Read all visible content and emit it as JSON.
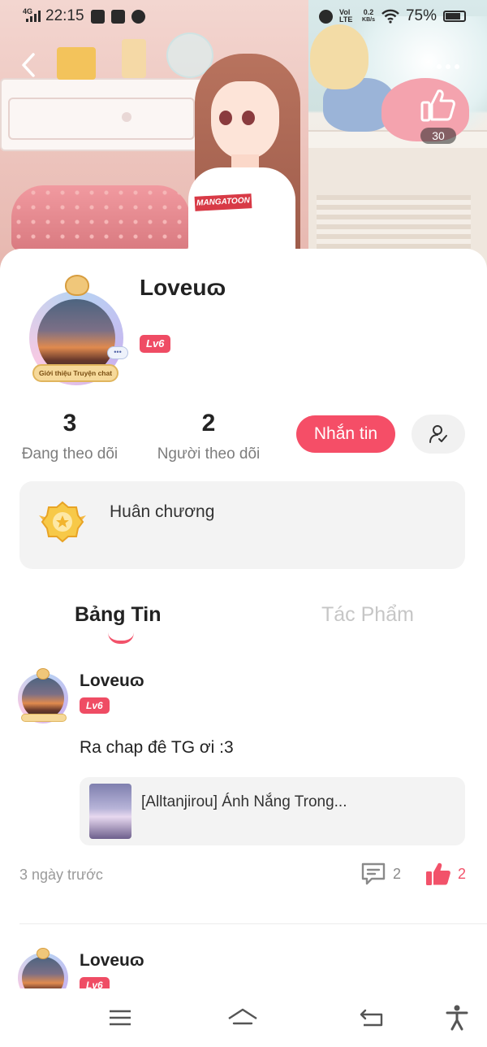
{
  "status_bar": {
    "network": "4G",
    "time": "22:15",
    "volte": "Vol LTE",
    "speed": "0.2",
    "speed_unit": "KB/s",
    "battery": "75%"
  },
  "header": {
    "back_icon": "chevron-left-icon",
    "more_icon": "more-dots-icon",
    "like_icon": "thumbs-up-icon",
    "likes": "30",
    "shirt_text": "MANGATOON"
  },
  "profile": {
    "username": "Loveuɷ",
    "level": "Lv6",
    "frame_caption": "Giới thiệu Truyện chat",
    "frame_bubble": "•••",
    "following_count": "3",
    "following_label": "Đang theo dõi",
    "followers_count": "2",
    "followers_label": "Người theo dõi",
    "message_button": "Nhắn tin",
    "follow_icon": "user-check-icon"
  },
  "medal": {
    "label": "Huân chương",
    "icon": "medal-badge-icon"
  },
  "tabs": [
    {
      "label": "Bảng Tin",
      "active": true
    },
    {
      "label": "Tác Phẩm",
      "active": false
    }
  ],
  "posts": [
    {
      "author": "Loveuɷ",
      "level": "Lv6",
      "text": "Ra chap đê TG ơi :3",
      "work_title": "[Alltanjirou] Ánh Nắng Trong...",
      "time": "3 ngày trước",
      "comments": "2",
      "likes": "2"
    },
    {
      "author": "Loveuɷ",
      "level": "Lv6"
    }
  ],
  "nav_bar": {
    "menu_icon": "menu-icon",
    "home_icon": "home-icon",
    "back_icon": "back-arrow-icon",
    "accessibility_icon": "accessibility-icon"
  },
  "colors": {
    "accent": "#f54e67",
    "muted_text": "#7d7d7d",
    "panel_bg": "#f3f3f3"
  }
}
